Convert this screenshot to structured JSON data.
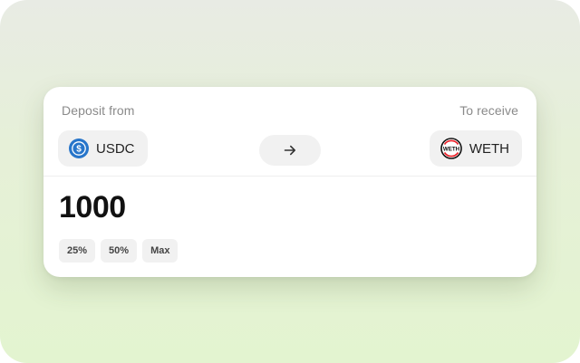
{
  "deposit": {
    "label": "Deposit from",
    "token": {
      "symbol": "USDC",
      "icon": "usdc-icon",
      "color": "#2775ca"
    }
  },
  "receive": {
    "label": "To receive",
    "token": {
      "symbol": "WETH",
      "icon": "weth-icon",
      "color": "#ec1c24"
    }
  },
  "arrow_icon": "arrow-right-icon",
  "amount": "1000",
  "quick_amounts": [
    "25%",
    "50%",
    "Max"
  ]
}
